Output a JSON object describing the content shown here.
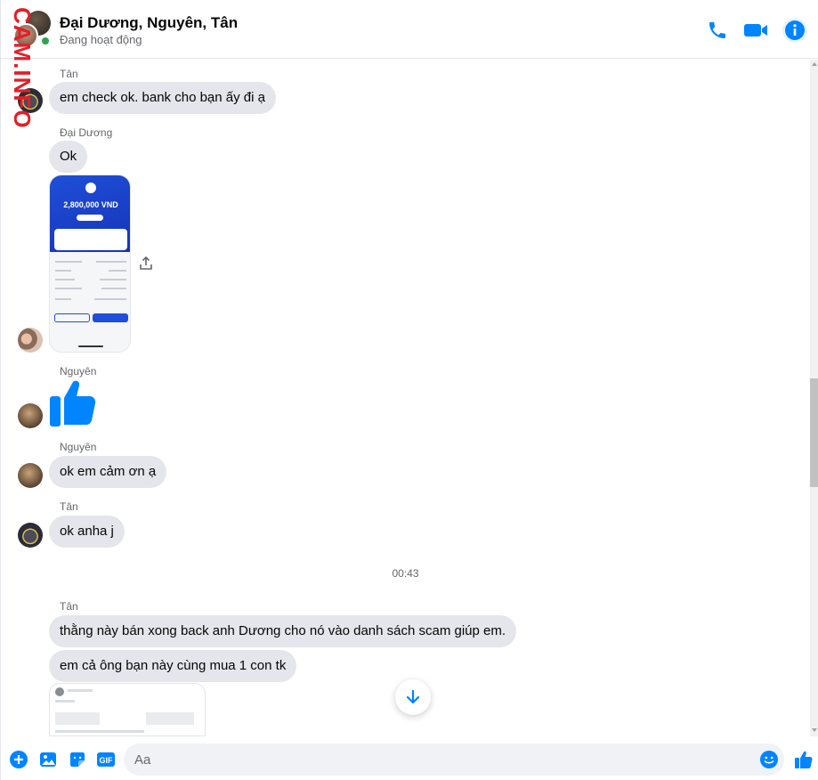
{
  "header": {
    "title": "Đại Dương, Nguyên, Tân",
    "status": "Đang hoạt động",
    "watermark": "CAM.INFO"
  },
  "messages": {
    "m1_sender": "Tân",
    "m1_text": "em check ok. bank cho bạn ấy đi ạ",
    "m2_sender": "Đại Dương",
    "m2_text": "Ok",
    "attachment_amount": "2,800,000 VND",
    "m3_sender": "Nguyên",
    "m4_sender": "Nguyên",
    "m4_text": "ok em cảm ơn ạ",
    "m5_sender": "Tân",
    "m5_text": "ok anha j",
    "timestamp": "00:43",
    "m6_sender": "Tân",
    "m6_text": "thằng này bán xong back anh Dương cho nó vào danh sách scam giúp em.",
    "m7_text": "em cả ông bạn này cùng mua 1 con tk"
  },
  "composer": {
    "placeholder": "Aa",
    "gif_label": "GIF"
  },
  "colors": {
    "accent": "#0084ff",
    "bubble": "#e4e6eb",
    "online": "#31a24c",
    "watermark": "#e41e26"
  },
  "icons": [
    "phone-icon",
    "video-icon",
    "info-icon",
    "plus-icon",
    "image-icon",
    "sticker-icon",
    "gif-icon",
    "emoji-icon",
    "like-icon",
    "share-icon",
    "arrow-down-icon"
  ]
}
